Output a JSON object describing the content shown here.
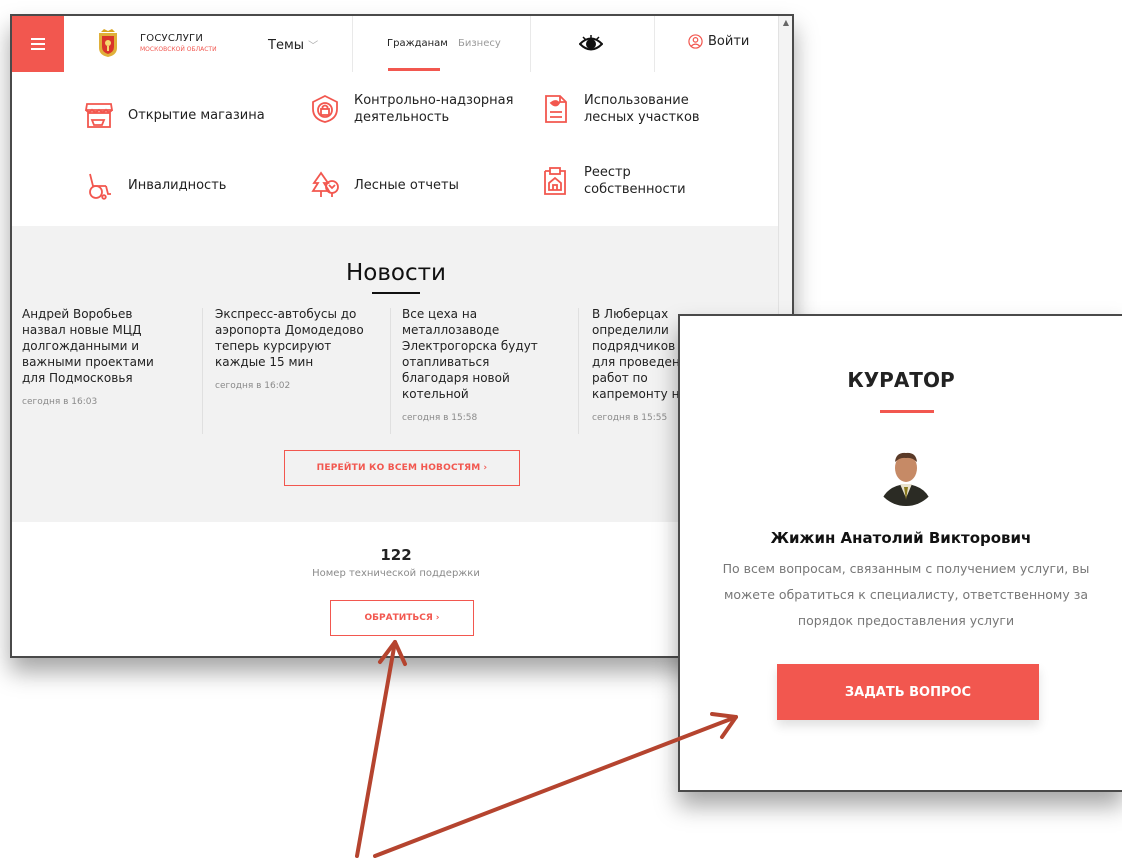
{
  "header": {
    "logo_title": "ГОСУСЛУГИ",
    "logo_subtitle": "МОСКОВСКОЙ ОБЛАСТИ",
    "themes_label": "Темы",
    "tab_citizens": "Гражданам",
    "tab_business": "Бизнесу",
    "login_label": "Войти"
  },
  "services": [
    {
      "label": "Открытие магазина",
      "icon": "shop-icon"
    },
    {
      "label": "Контрольно-надзорная деятельность",
      "icon": "lock-shield-icon"
    },
    {
      "label": "Использование лесных участков",
      "icon": "forest-document-icon"
    },
    {
      "label": "Инвалидность",
      "icon": "wheelchair-icon"
    },
    {
      "label": "Лесные отчеты",
      "icon": "tree-icon"
    },
    {
      "label": "Реестр собственности",
      "icon": "property-registry-icon"
    }
  ],
  "news": {
    "title": "Новости",
    "items": [
      {
        "text": "Андрей Воробьев назвал новые МЦД долгожданными и важными проектами для Подмосковья",
        "time": "сегодня в 16:03"
      },
      {
        "text": "Экспресс-автобусы до аэропорта Домодедово теперь курсируют каждые 15 мин",
        "time": "сегодня в 16:02"
      },
      {
        "text": "Все цеха на металлозаводе Электрогорска будут отапливаться благодаря новой котельной",
        "time": "сегодня в 15:58"
      },
      {
        "text": "В Люберцах определили подрядчиков для проведения работ по капремонту на",
        "time": "сегодня в 15:55"
      }
    ],
    "all_news_button": "ПЕРЕЙТИ КО ВСЕМ НОВОСТЯМ"
  },
  "support": {
    "number": "122",
    "label": "Номер технической поддержки",
    "contact_button": "ОБРАТИТЬСЯ"
  },
  "curator": {
    "title": "КУРАТОР",
    "name": "Жижин Анатолий Викторович",
    "description": "По всем вопросам, связанным с получением услуги, вы можете обратиться к специалисту, ответственному за порядок предоставления услуги",
    "ask_button": "ЗАДАТЬ ВОПРОС"
  },
  "colors": {
    "accent": "#f2574f",
    "arrow": "#b5442f",
    "news_bg": "#f2f2f2"
  }
}
